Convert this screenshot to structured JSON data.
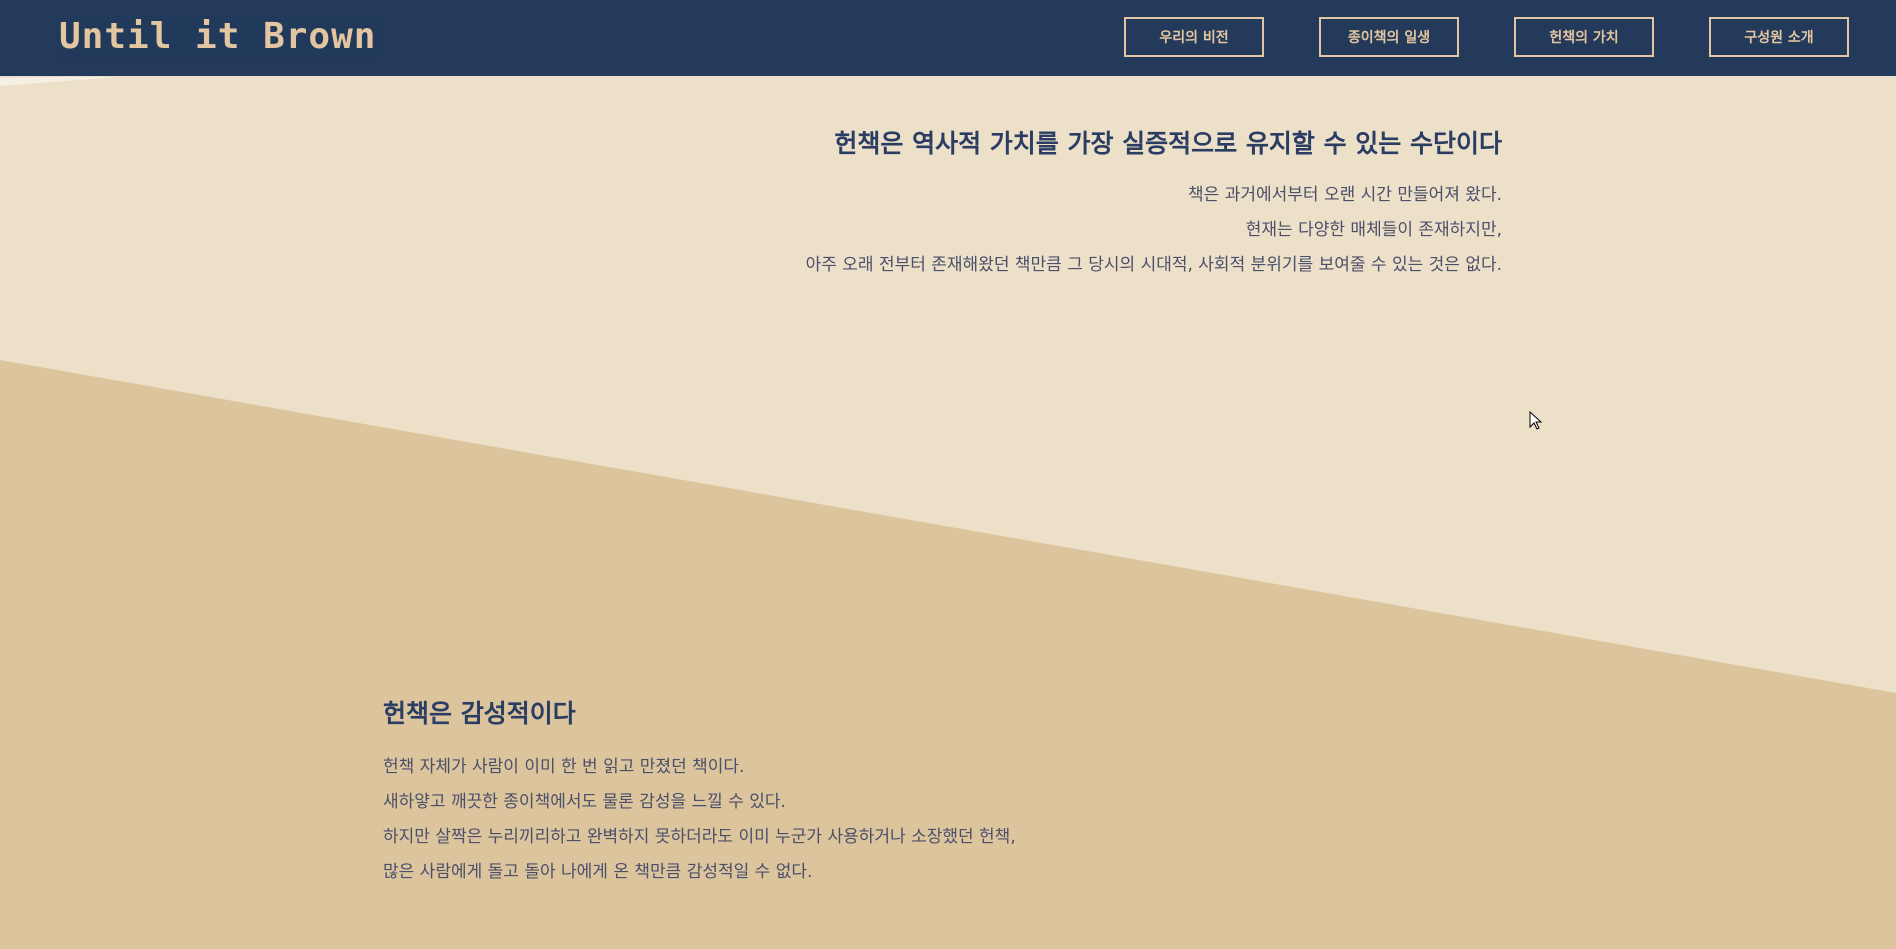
{
  "header": {
    "logo": "Until it Brown",
    "nav": [
      "우리의 비전",
      "종이책의 일생",
      "헌책의 가치",
      "구성원 소개"
    ]
  },
  "section1": {
    "title": "헌책은 역사적 가치를 가장 실증적으로 유지할 수 있는 수단이다",
    "lines": [
      "책은 과거에서부터 오랜 시간 만들어져 왔다.",
      "현재는 다양한 매체들이 존재하지만,",
      "아주 오래 전부터 존재해왔던 책만큼 그 당시의 시대적, 사회적 분위기를 보여줄 수 있는 것은 없다."
    ]
  },
  "section2": {
    "title": "헌책은 감성적이다",
    "lines": [
      "헌책 자체가 사람이 이미 한 번 읽고 만졌던 책이다.",
      "새하얗고 깨끗한 종이책에서도 물론 감성을 느낄 수 있다.",
      "하지만 살짝은 누리끼리하고 완벽하지 못하더라도 이미 누군가 사용하거나 소장했던 헌책,",
      "많은 사람에게 돌고 돌아 나에게 온 책만큼 감성적일 수 없다."
    ]
  },
  "colors": {
    "header": "#243a5b",
    "accent": "#e3c6a1",
    "light": "#ece0c9",
    "tan": "#dcc59d",
    "heading": "#2b3d62"
  }
}
